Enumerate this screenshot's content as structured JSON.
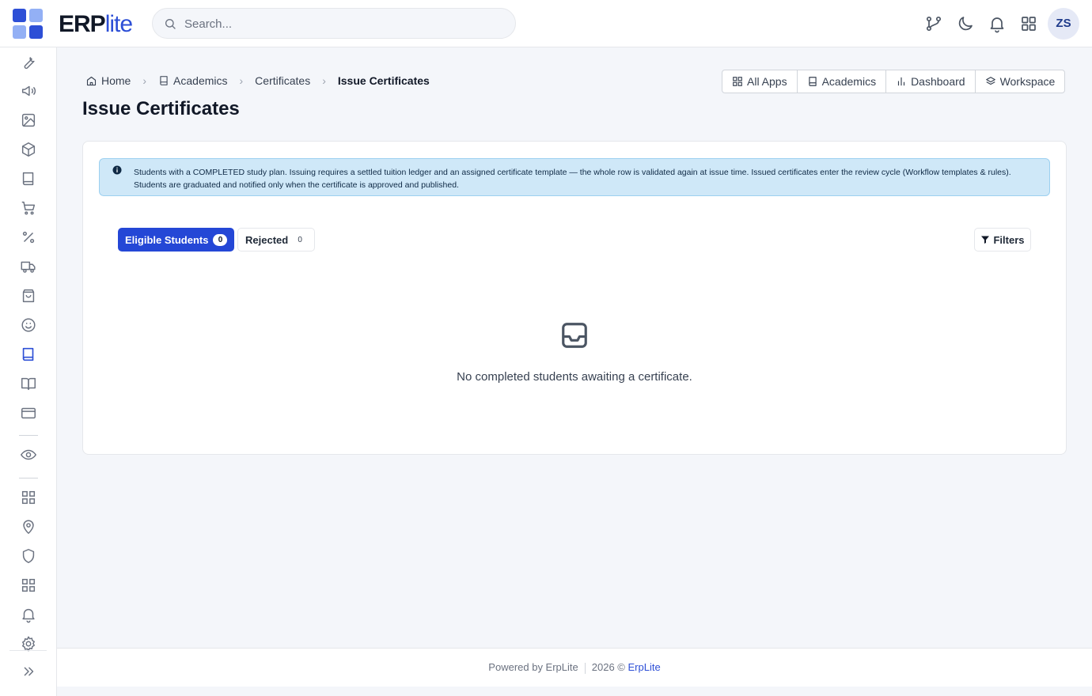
{
  "brand": {
    "name_bold": "ERP",
    "name_light": "lite",
    "colors": {
      "primary": "#2d4fd6",
      "light": "#93b0f5"
    }
  },
  "search": {
    "placeholder": "Search..."
  },
  "topbar": {
    "icons": [
      "git-branch-icon",
      "moon-icon",
      "bell-icon",
      "apps-grid-icon"
    ],
    "user_initials": "ZS"
  },
  "sidebar": {
    "items": [
      "wrench-icon",
      "megaphone-icon",
      "image-icon",
      "box-icon",
      "book-icon",
      "cart-icon",
      "percent-icon",
      "truck-icon",
      "shopping-bag-icon",
      "smile-icon",
      "book-icon",
      "book-open-icon",
      "credit-card-icon",
      "eye-icon",
      "apps-grid-icon",
      "map-pin-icon",
      "shield-icon",
      "apps-grid-icon",
      "bell-icon",
      "gear-icon",
      "expand-icon"
    ],
    "active": "book-icon"
  },
  "breadcrumb": {
    "home": "Home",
    "academics": "Academics",
    "certificates": "Certificates",
    "current": "Issue Certificates"
  },
  "page": {
    "title": "Issue Certificates"
  },
  "quicklinks": {
    "all_apps": "All Apps",
    "academics": "Academics",
    "dashboard": "Dashboard",
    "workspace": "Workspace"
  },
  "alert": {
    "text": "Students with a COMPLETED study plan. Issuing requires a settled tuition ledger and an assigned certificate template — the whole row is validated again at issue time. Issued certificates enter the review cycle (Workflow templates & rules). Students are graduated and notified only when the certificate is approved and published."
  },
  "tabs": {
    "eligible": {
      "label": "Eligible Students",
      "count": "0"
    },
    "rejected": {
      "label": "Rejected",
      "count": "0"
    }
  },
  "filters": {
    "label": "Filters"
  },
  "empty": {
    "icon": "inbox-icon",
    "text": "No completed students awaiting a certificate."
  },
  "footer": {
    "powered": "Powered by ErpLite",
    "year": "2026 ©",
    "link": "ErpLite"
  }
}
